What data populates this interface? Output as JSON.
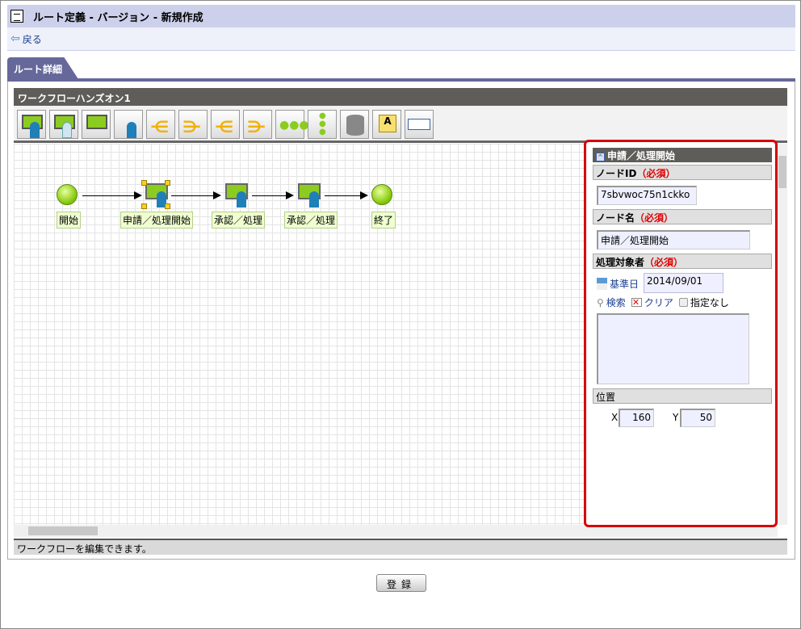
{
  "header": {
    "title": "ルート定義 - バージョン - 新規作成",
    "back_label": "戻る"
  },
  "tab": {
    "label": "ルート詳細"
  },
  "workflow": {
    "name": "ワークフローハンズオン1",
    "status": "ワークフローを編集できます。"
  },
  "toolbar": [
    "user-task",
    "user-task-alt",
    "system-task",
    "participant",
    "split",
    "join",
    "conditional-split",
    "conditional-join",
    "sequence",
    "parallel",
    "database",
    "annotation",
    "panel"
  ],
  "nodes": [
    {
      "label": "開始",
      "type": "start"
    },
    {
      "label": "申請／処理開始",
      "type": "task",
      "selected": true
    },
    {
      "label": "承認／処理",
      "type": "task"
    },
    {
      "label": "承認／処理",
      "type": "task"
    },
    {
      "label": "終了",
      "type": "end"
    }
  ],
  "properties": {
    "title": "申請／処理開始",
    "node_id_label": "ノードID",
    "required": "（必須）",
    "node_id": "7sbvwoc75n1ckko",
    "node_name_label": "ノード名",
    "node_name": "申請／処理開始",
    "target_label": "処理対象者",
    "base_date_label": "基準日",
    "base_date": "2014/09/01",
    "search_label": "検索",
    "clear_label": "クリア",
    "none_label": "指定なし",
    "position_label": "位置",
    "x_label": "X",
    "x": "160",
    "y_label": "Y",
    "y": "50"
  },
  "register_label": "登録"
}
